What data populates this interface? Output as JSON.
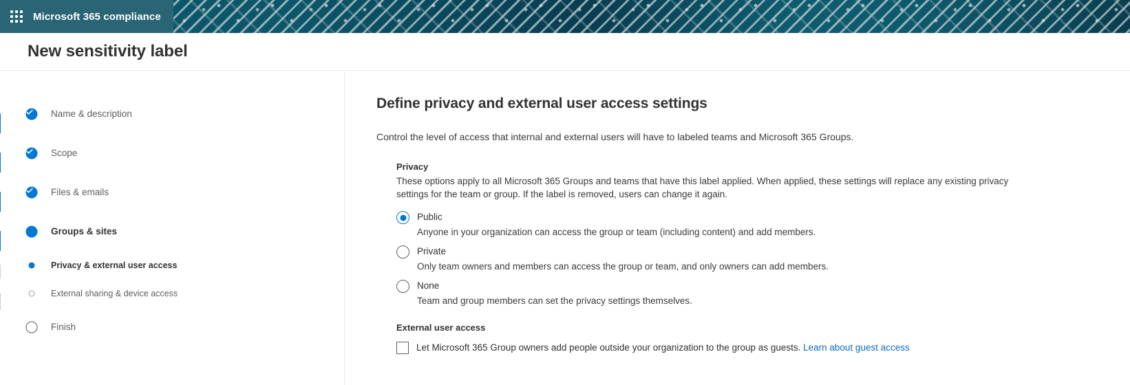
{
  "suite": {
    "waffle_icon": "app-launcher-waffle-icon",
    "title": "Microsoft 365 compliance"
  },
  "page": {
    "title": "New sensitivity label"
  },
  "wizard": {
    "steps": [
      {
        "label": "Name & description",
        "state": "done",
        "level": "major"
      },
      {
        "label": "Scope",
        "state": "done",
        "level": "major"
      },
      {
        "label": "Files & emails",
        "state": "done",
        "level": "major"
      },
      {
        "label": "Groups & sites",
        "state": "current",
        "level": "major"
      },
      {
        "label": "Privacy & external user access",
        "state": "sub-current",
        "level": "sub"
      },
      {
        "label": "External sharing & device access",
        "state": "sub-todo",
        "level": "sub"
      },
      {
        "label": "Finish",
        "state": "todo",
        "level": "major"
      }
    ]
  },
  "main": {
    "heading": "Define privacy and external user access settings",
    "lead": "Control the level of access that internal and external users will have to labeled teams and Microsoft 365 Groups.",
    "privacy": {
      "heading": "Privacy",
      "description": "These options apply to all Microsoft 365 Groups and teams that have this label applied. When applied, these settings will replace any existing privacy settings for the team or group. If the label is removed, users can change it again.",
      "options": [
        {
          "label": "Public",
          "description": "Anyone in your organization can access the group or team (including content) and add members.",
          "checked": true
        },
        {
          "label": "Private",
          "description": "Only team owners and members can access the group or team, and only owners can add members.",
          "checked": false
        },
        {
          "label": "None",
          "description": "Team and group members can set the privacy settings themselves.",
          "checked": false
        }
      ]
    },
    "external": {
      "heading": "External user access",
      "checkbox_label": "Let Microsoft 365 Group owners add people outside your organization to the group as guests.",
      "checkbox_checked": false,
      "link_text": "Learn about guest access"
    }
  },
  "colors": {
    "accent": "#0078d4",
    "link": "#0f6cbd",
    "suite_bar": "#2a6575",
    "banner": "#0d4353",
    "text": "#323130"
  }
}
